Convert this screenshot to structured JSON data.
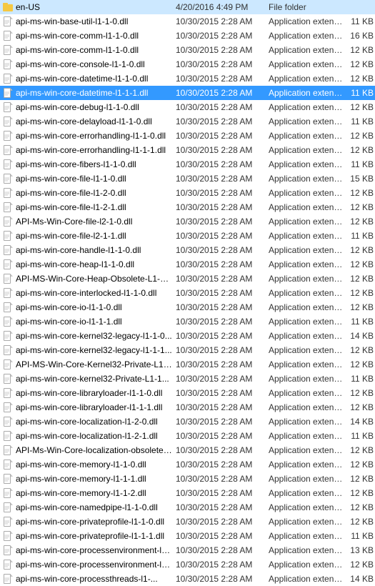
{
  "files": [
    {
      "name": "en-US",
      "date": "4/20/2016 4:49 PM",
      "type": "File folder",
      "size": "",
      "selected": false,
      "isFolder": true
    },
    {
      "name": "api-ms-win-base-util-l1-1-0.dll",
      "date": "10/30/2015 2:28 AM",
      "type": "Application extens...",
      "size": "11 KB",
      "selected": false,
      "isFolder": false
    },
    {
      "name": "api-ms-win-core-comm-l1-1-0.dll",
      "date": "10/30/2015 2:28 AM",
      "type": "Application extens...",
      "size": "16 KB",
      "selected": false,
      "isFolder": false
    },
    {
      "name": "api-ms-win-core-comm-l1-1-0.dll",
      "date": "10/30/2015 2:28 AM",
      "type": "Application extens...",
      "size": "12 KB",
      "selected": false,
      "isFolder": false
    },
    {
      "name": "api-ms-win-core-console-l1-1-0.dll",
      "date": "10/30/2015 2:28 AM",
      "type": "Application extens...",
      "size": "12 KB",
      "selected": false,
      "isFolder": false
    },
    {
      "name": "api-ms-win-core-datetime-l1-1-0.dll",
      "date": "10/30/2015 2:28 AM",
      "type": "Application extens...",
      "size": "12 KB",
      "selected": false,
      "isFolder": false
    },
    {
      "name": "api-ms-win-core-datetime-l1-1-1.dll",
      "date": "10/30/2015 2:28 AM",
      "type": "Application extens...",
      "size": "11 KB",
      "selected": true,
      "isFolder": false
    },
    {
      "name": "api-ms-win-core-debug-l1-1-0.dll",
      "date": "10/30/2015 2:28 AM",
      "type": "Application extens...",
      "size": "12 KB",
      "selected": false,
      "isFolder": false
    },
    {
      "name": "api-ms-win-core-delayload-l1-1-0.dll",
      "date": "10/30/2015 2:28 AM",
      "type": "Application extens...",
      "size": "11 KB",
      "selected": false,
      "isFolder": false
    },
    {
      "name": "api-ms-win-core-errorhandling-l1-1-0.dll",
      "date": "10/30/2015 2:28 AM",
      "type": "Application extens...",
      "size": "12 KB",
      "selected": false,
      "isFolder": false
    },
    {
      "name": "api-ms-win-core-errorhandling-l1-1-1.dll",
      "date": "10/30/2015 2:28 AM",
      "type": "Application extens...",
      "size": "12 KB",
      "selected": false,
      "isFolder": false
    },
    {
      "name": "api-ms-win-core-fibers-l1-1-0.dll",
      "date": "10/30/2015 2:28 AM",
      "type": "Application extens...",
      "size": "11 KB",
      "selected": false,
      "isFolder": false
    },
    {
      "name": "api-ms-win-core-file-l1-1-0.dll",
      "date": "10/30/2015 2:28 AM",
      "type": "Application extens...",
      "size": "15 KB",
      "selected": false,
      "isFolder": false
    },
    {
      "name": "api-ms-win-core-file-l1-2-0.dll",
      "date": "10/30/2015 2:28 AM",
      "type": "Application extens...",
      "size": "12 KB",
      "selected": false,
      "isFolder": false
    },
    {
      "name": "api-ms-win-core-file-l1-2-1.dll",
      "date": "10/30/2015 2:28 AM",
      "type": "Application extens...",
      "size": "12 KB",
      "selected": false,
      "isFolder": false
    },
    {
      "name": "API-Ms-Win-Core-file-l2-1-0.dll",
      "date": "10/30/2015 2:28 AM",
      "type": "Application extens...",
      "size": "12 KB",
      "selected": false,
      "isFolder": false
    },
    {
      "name": "api-ms-win-core-file-l2-1-1.dll",
      "date": "10/30/2015 2:28 AM",
      "type": "Application extens...",
      "size": "11 KB",
      "selected": false,
      "isFolder": false
    },
    {
      "name": "api-ms-win-core-handle-l1-1-0.dll",
      "date": "10/30/2015 2:28 AM",
      "type": "Application extens...",
      "size": "12 KB",
      "selected": false,
      "isFolder": false
    },
    {
      "name": "api-ms-win-core-heap-l1-1-0.dll",
      "date": "10/30/2015 2:28 AM",
      "type": "Application extens...",
      "size": "12 KB",
      "selected": false,
      "isFolder": false
    },
    {
      "name": "API-MS-Win-Core-Heap-Obsolete-L1-1-...",
      "date": "10/30/2015 2:28 AM",
      "type": "Application extens...",
      "size": "12 KB",
      "selected": false,
      "isFolder": false
    },
    {
      "name": "api-ms-win-core-interlocked-l1-1-0.dll",
      "date": "10/30/2015 2:28 AM",
      "type": "Application extens...",
      "size": "12 KB",
      "selected": false,
      "isFolder": false
    },
    {
      "name": "api-ms-win-core-io-l1-1-0.dll",
      "date": "10/30/2015 2:28 AM",
      "type": "Application extens...",
      "size": "12 KB",
      "selected": false,
      "isFolder": false
    },
    {
      "name": "api-ms-win-core-io-l1-1-1.dll",
      "date": "10/30/2015 2:28 AM",
      "type": "Application extens...",
      "size": "11 KB",
      "selected": false,
      "isFolder": false
    },
    {
      "name": "api-ms-win-core-kernel32-legacy-l1-1-0...",
      "date": "10/30/2015 2:28 AM",
      "type": "Application extens...",
      "size": "14 KB",
      "selected": false,
      "isFolder": false
    },
    {
      "name": "api-ms-win-core-kernel32-legacy-l1-1-1...",
      "date": "10/30/2015 2:28 AM",
      "type": "Application extens...",
      "size": "12 KB",
      "selected": false,
      "isFolder": false
    },
    {
      "name": "API-MS-Win-Core-Kernel32-Private-L1-1...",
      "date": "10/30/2015 2:28 AM",
      "type": "Application extens...",
      "size": "12 KB",
      "selected": false,
      "isFolder": false
    },
    {
      "name": "api-ms-win-core-kernel32-Private-L1-1...",
      "date": "10/30/2015 2:28 AM",
      "type": "Application extens...",
      "size": "11 KB",
      "selected": false,
      "isFolder": false
    },
    {
      "name": "api-ms-win-core-libraryloader-l1-1-0.dll",
      "date": "10/30/2015 2:28 AM",
      "type": "Application extens...",
      "size": "12 KB",
      "selected": false,
      "isFolder": false
    },
    {
      "name": "api-ms-win-core-libraryloader-l1-1-1.dll",
      "date": "10/30/2015 2:28 AM",
      "type": "Application extens...",
      "size": "12 KB",
      "selected": false,
      "isFolder": false
    },
    {
      "name": "api-ms-win-core-localization-l1-2-0.dll",
      "date": "10/30/2015 2:28 AM",
      "type": "Application extens...",
      "size": "14 KB",
      "selected": false,
      "isFolder": false
    },
    {
      "name": "api-ms-win-core-localization-l1-2-1.dll",
      "date": "10/30/2015 2:28 AM",
      "type": "Application extens...",
      "size": "11 KB",
      "selected": false,
      "isFolder": false
    },
    {
      "name": "API-Ms-Win-Core-localization-obsolete-l...",
      "date": "10/30/2015 2:28 AM",
      "type": "Application extens...",
      "size": "12 KB",
      "selected": false,
      "isFolder": false
    },
    {
      "name": "api-ms-win-core-memory-l1-1-0.dll",
      "date": "10/30/2015 2:28 AM",
      "type": "Application extens...",
      "size": "12 KB",
      "selected": false,
      "isFolder": false
    },
    {
      "name": "api-ms-win-core-memory-l1-1-1.dll",
      "date": "10/30/2015 2:28 AM",
      "type": "Application extens...",
      "size": "12 KB",
      "selected": false,
      "isFolder": false
    },
    {
      "name": "api-ms-win-core-memory-l1-1-2.dll",
      "date": "10/30/2015 2:28 AM",
      "type": "Application extens...",
      "size": "12 KB",
      "selected": false,
      "isFolder": false
    },
    {
      "name": "api-ms-win-core-namedpipe-l1-1-0.dll",
      "date": "10/30/2015 2:28 AM",
      "type": "Application extens...",
      "size": "12 KB",
      "selected": false,
      "isFolder": false
    },
    {
      "name": "api-ms-win-core-privateprofile-l1-1-0.dll",
      "date": "10/30/2015 2:28 AM",
      "type": "Application extens...",
      "size": "12 KB",
      "selected": false,
      "isFolder": false
    },
    {
      "name": "api-ms-win-core-privateprofile-l1-1-1.dll",
      "date": "10/30/2015 2:28 AM",
      "type": "Application extens...",
      "size": "11 KB",
      "selected": false,
      "isFolder": false
    },
    {
      "name": "api-ms-win-core-processenvironment-l1-...",
      "date": "10/30/2015 2:28 AM",
      "type": "Application extens...",
      "size": "13 KB",
      "selected": false,
      "isFolder": false
    },
    {
      "name": "api-ms-win-core-processenvironment-l1-...",
      "date": "10/30/2015 2:28 AM",
      "type": "Application extens...",
      "size": "12 KB",
      "selected": false,
      "isFolder": false
    },
    {
      "name": "api-ms-win-core-processthreads-l1-...",
      "date": "10/30/2015 2:28 AM",
      "type": "Application extens...",
      "size": "14 KB",
      "selected": false,
      "isFolder": false
    }
  ]
}
